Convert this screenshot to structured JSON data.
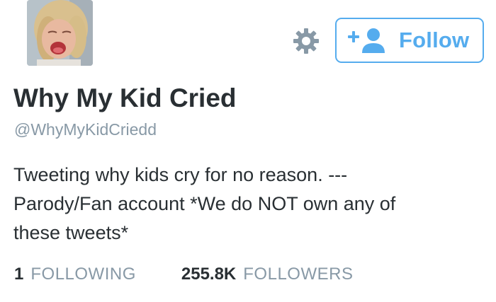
{
  "profile": {
    "avatar_icon": "crying-child-photo",
    "display_name": "Why My Kid Cried",
    "handle": "@WhyMyKidCriedd",
    "bio_lines": [
      "Tweeting why kids cry for no reason. ---",
      "Parody/Fan account *We do NOT own any of",
      "these tweets*"
    ]
  },
  "actions": {
    "settings_icon": "gear-icon",
    "follow_icon": "add-user-icon",
    "follow_label": "Follow"
  },
  "stats": {
    "following_count": "1",
    "following_label": "FOLLOWING",
    "followers_count": "255.8K",
    "followers_label": "FOLLOWERS"
  },
  "colors": {
    "accent": "#55acee",
    "text_primary": "#292f33",
    "text_secondary": "#8899a6",
    "background": "#ffffff"
  }
}
